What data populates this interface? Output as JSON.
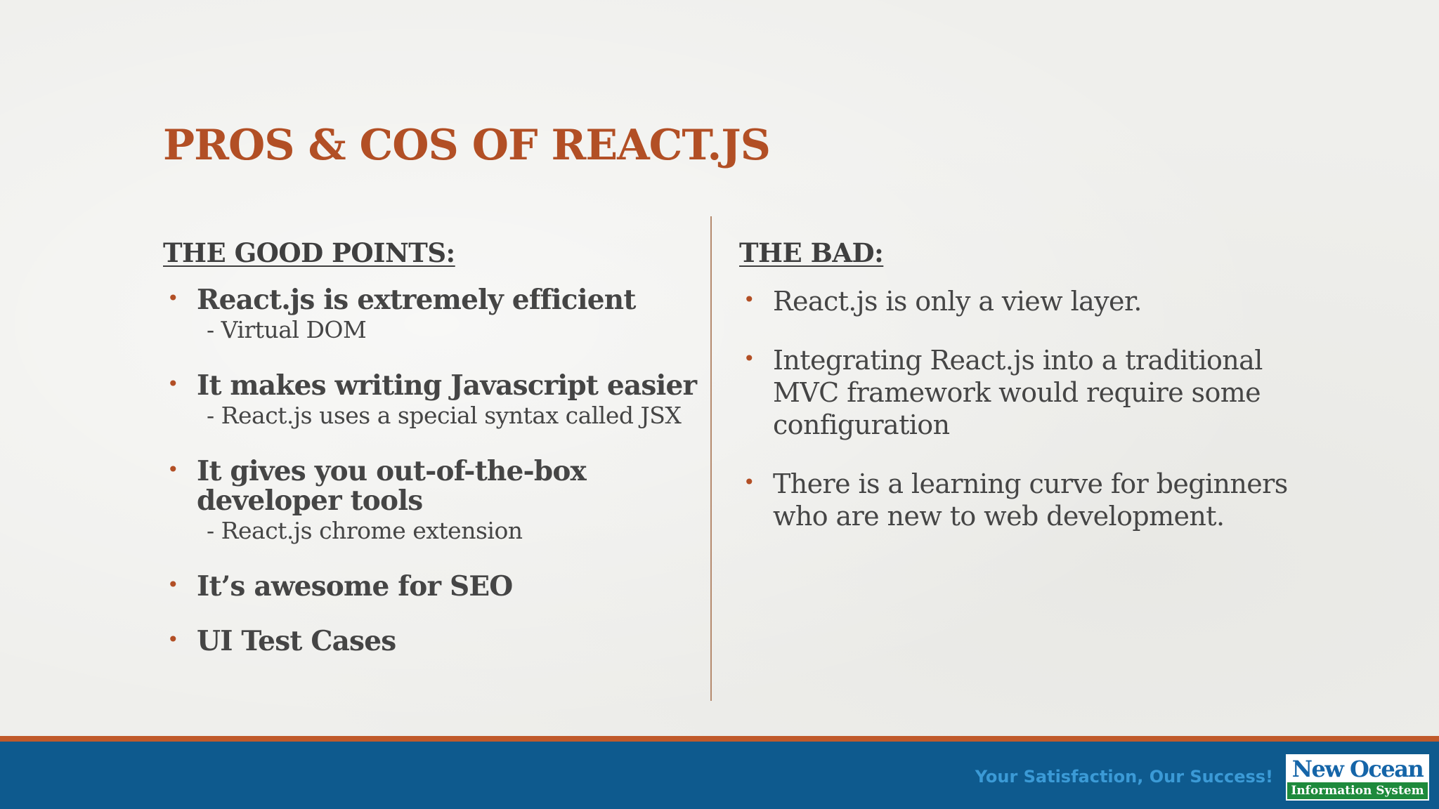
{
  "slide": {
    "title": "PROS & COS OF REACT.JS",
    "good": {
      "heading": "THE GOOD POINTS:",
      "items": [
        {
          "main": "React.js is extremely efficient",
          "sub": "- Virtual DOM"
        },
        {
          "main": "It makes writing Javascript easier",
          "sub": "- React.js uses a special syntax called JSX"
        },
        {
          "main": "It gives you out-of-the-box developer tools",
          "sub": "- React.js chrome extension"
        },
        {
          "main": "It’s awesome for SEO",
          "sub": ""
        },
        {
          "main": "UI Test Cases",
          "sub": ""
        }
      ]
    },
    "bad": {
      "heading": "THE BAD:",
      "items": [
        "React.js is only a view layer.",
        "Integrating React.js into a traditional MVC framework would require some configuration",
        "There is a learning curve for beginners who are new to web development."
      ]
    },
    "bullet_glyph": "•"
  },
  "footer": {
    "tagline": "Your Satisfaction, Our Success!",
    "logo_top": "New Ocean",
    "logo_bottom": "Information System"
  },
  "colors": {
    "accent": "#b24f25",
    "footer_bar": "#0e5a8e",
    "footer_stripe": "#c05a2b",
    "text": "#454545"
  }
}
